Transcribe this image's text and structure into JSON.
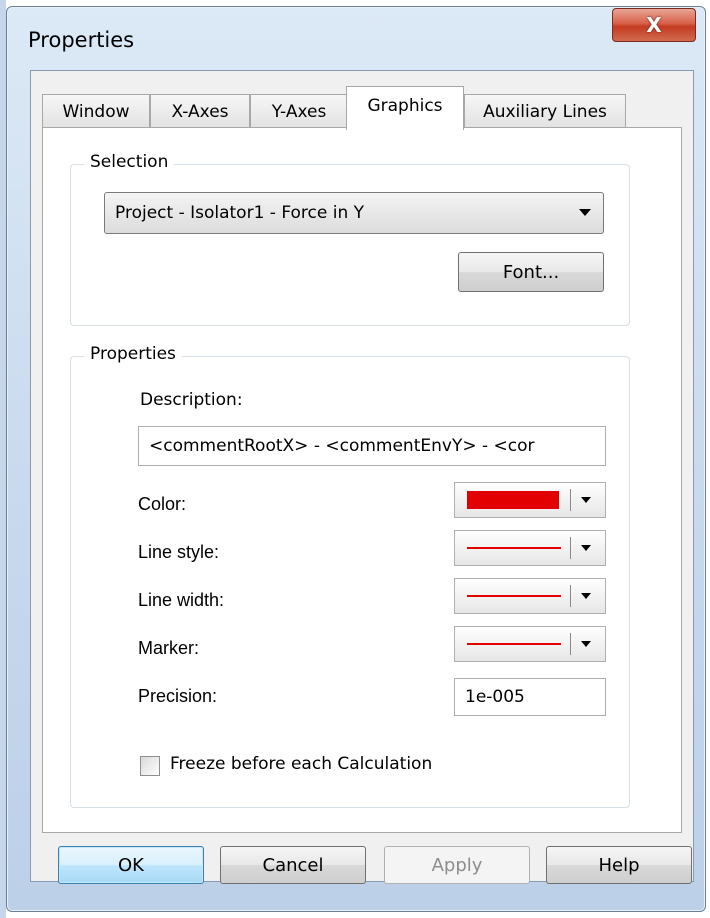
{
  "window": {
    "title": "Properties",
    "close_label": "X"
  },
  "tabs": [
    "Window",
    "X-Axes",
    "Y-Axes",
    "Graphics",
    "Auxiliary Lines"
  ],
  "active_tab": "Graphics",
  "selection": {
    "group_label": "Selection",
    "combo_value": "Project - Isolator1 - Force in Y",
    "font_button": "Font..."
  },
  "properties": {
    "group_label": "Properties",
    "description_label": "Description:",
    "description_value": "<commentRootX> - <commentEnvY> - <cor",
    "color_label": "Color:",
    "line_style_label": "Line style:",
    "line_width_label": "Line width:",
    "marker_label": "Marker:",
    "precision_label": "Precision:",
    "precision_value": "1e-005",
    "freeze_label": "Freeze before each Calculation",
    "freeze_checked": false,
    "color_value": "#e30000",
    "line_color": "#e30000"
  },
  "buttons": {
    "ok": "OK",
    "cancel": "Cancel",
    "apply": "Apply",
    "help": "Help"
  }
}
